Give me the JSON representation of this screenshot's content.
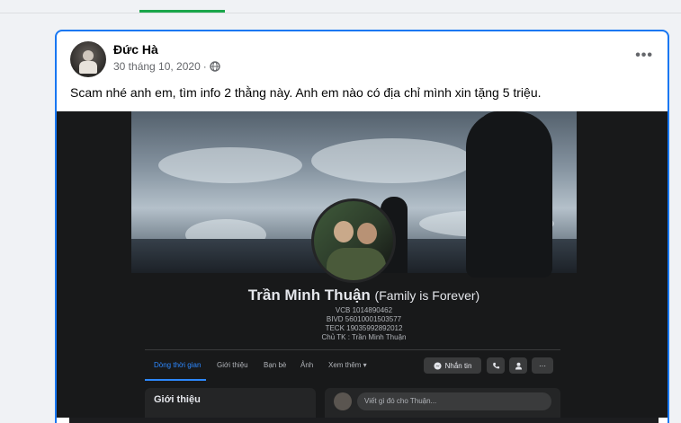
{
  "post": {
    "author": "Đức Hà",
    "date": "30 tháng 10, 2020",
    "date_separator": "·",
    "privacy_icon": "globe-icon",
    "more_label": "•••",
    "caption": "Scam nhé anh em, tìm info 2 thằng này. Anh em nào có địa chỉ mình xin tặng 5 triệu."
  },
  "profile": {
    "name": "Trần Minh Thuận",
    "nickname": "(Family is Forever)",
    "bio_lines": [
      "VCB 1014890462",
      "BIVD 56010001503577",
      "TECK 19035992892012",
      "Chủ TK : Trần Minh Thuận"
    ],
    "tabs": [
      "Dòng thời gian",
      "Giới thiệu",
      "Bạn bè",
      "Ảnh",
      "Xem thêm ▾"
    ],
    "message_button": "Nhắn tin",
    "more_button": "···",
    "intro_heading": "Giới thiệu",
    "composer_placeholder": "Viết gì đó cho Thuận..."
  },
  "colors": {
    "accent": "#1877f2",
    "active_tab_dark": "#2d88ff",
    "dark_bg": "#18191a"
  }
}
